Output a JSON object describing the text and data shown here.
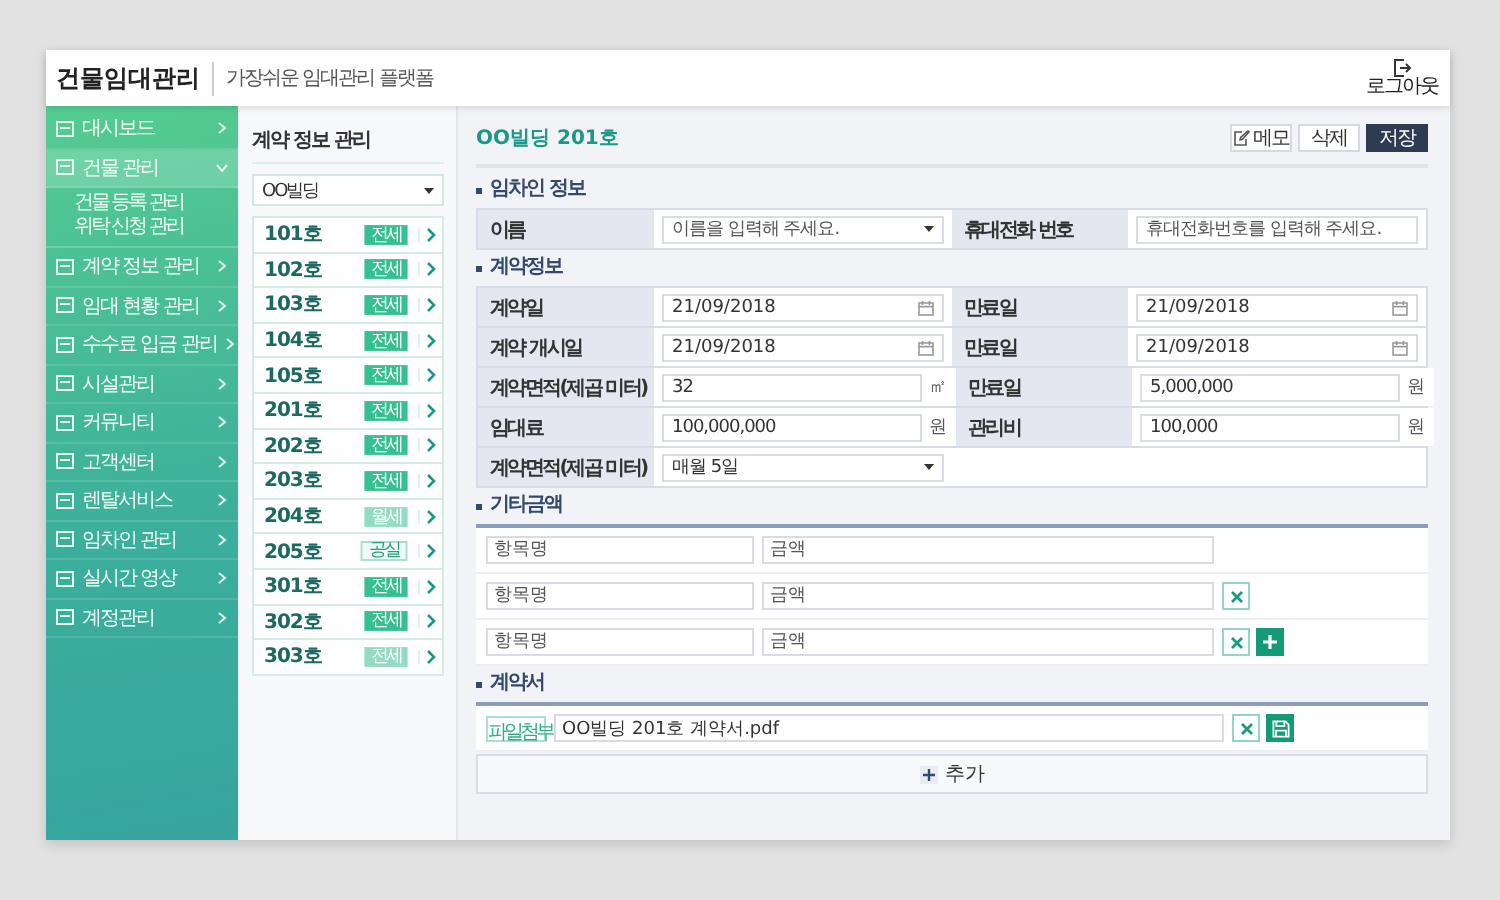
{
  "header": {
    "title": "건물임대관리",
    "subtitle": "가장쉬운 임대관리 플랫폼",
    "logout": "로그아웃"
  },
  "sidebar": {
    "items": [
      {
        "label": "대시보드",
        "selected": false,
        "expanded": false
      },
      {
        "label": "건물 관리",
        "selected": true,
        "expanded": true,
        "children": [
          {
            "label": "건물 등록 관리"
          },
          {
            "label": "위탁 신청 관리"
          }
        ]
      },
      {
        "label": "계약 정보 관리",
        "selected": false,
        "expanded": false
      },
      {
        "label": "임대 현황 관리",
        "selected": false,
        "expanded": false
      },
      {
        "label": "수수료 입금 관리",
        "selected": false,
        "expanded": false
      },
      {
        "label": "시설관리",
        "selected": false,
        "expanded": false
      },
      {
        "label": "커뮤니티",
        "selected": false,
        "expanded": false
      },
      {
        "label": "고객센터",
        "selected": false,
        "expanded": false
      },
      {
        "label": "렌탈서비스",
        "selected": false,
        "expanded": false
      },
      {
        "label": "임차인 관리",
        "selected": false,
        "expanded": false
      },
      {
        "label": "실시간 영상",
        "selected": false,
        "expanded": false
      },
      {
        "label": "계정관리",
        "selected": false,
        "expanded": false
      }
    ]
  },
  "units": {
    "title": "계약 정보 관리",
    "building": "OO빌딩",
    "items": [
      {
        "name": "101호",
        "badge": "전세",
        "kind": "solid"
      },
      {
        "name": "102호",
        "badge": "전세",
        "kind": "solid"
      },
      {
        "name": "103호",
        "badge": "전세",
        "kind": "solid"
      },
      {
        "name": "104호",
        "badge": "전세",
        "kind": "solid"
      },
      {
        "name": "105호",
        "badge": "전세",
        "kind": "solid"
      },
      {
        "name": "201호",
        "badge": "전세",
        "kind": "solid"
      },
      {
        "name": "202호",
        "badge": "전세",
        "kind": "solid"
      },
      {
        "name": "203호",
        "badge": "전세",
        "kind": "solid"
      },
      {
        "name": "204호",
        "badge": "월세",
        "kind": "light"
      },
      {
        "name": "205호",
        "badge": "공실",
        "kind": "outline"
      },
      {
        "name": "301호",
        "badge": "전세",
        "kind": "solid"
      },
      {
        "name": "302호",
        "badge": "전세",
        "kind": "solid"
      },
      {
        "name": "303호",
        "badge": "전세",
        "kind": "light"
      }
    ]
  },
  "detail": {
    "title": "OO빌딩 201호",
    "buttons": [
      {
        "label": "메모",
        "kind": "memo"
      },
      {
        "label": "삭제",
        "kind": "plain"
      },
      {
        "label": "저장",
        "kind": "primary"
      }
    ],
    "tenant": {
      "title": "임차인 정보",
      "rows": [
        {
          "cells": [
            {
              "label": "이름",
              "kind": "select",
              "placeholder": "이름을 입력해 주세요."
            },
            {
              "label": "휴대전화 번호",
              "kind": "text",
              "placeholder": "휴대전화번호를 입력해 주세요."
            }
          ]
        }
      ]
    },
    "contract": {
      "title": "계약정보",
      "rows": [
        {
          "cells": [
            {
              "label": "계약일",
              "kind": "date",
              "value": "21/09/2018"
            },
            {
              "label": "만료일",
              "kind": "date",
              "value": "21/09/2018"
            }
          ]
        },
        {
          "cells": [
            {
              "label": "계약 개시일",
              "kind": "date",
              "value": "21/09/2018"
            },
            {
              "label": "만료일",
              "kind": "date",
              "value": "21/09/2018"
            }
          ]
        },
        {
          "cells": [
            {
              "label": "계약면적(제곱 미터)",
              "kind": "text",
              "value": "32",
              "unit": "㎡"
            },
            {
              "label": "만료일",
              "kind": "text",
              "value": "5,000,000",
              "unit": "원"
            }
          ]
        },
        {
          "cells": [
            {
              "label": "임대료",
              "kind": "text",
              "value": "100,000,000",
              "unit": "원"
            },
            {
              "label": "관리비",
              "kind": "text",
              "value": "100,000",
              "unit": "원"
            }
          ]
        },
        {
          "cells": [
            {
              "label": "계약면적(제곱 미터)",
              "kind": "select",
              "value": "매월 5일"
            }
          ]
        }
      ]
    },
    "extra": {
      "title": "기타금액",
      "rows": [
        {
          "name_placeholder": "항목명",
          "amount_placeholder": "금액",
          "removable": false,
          "addable": false
        },
        {
          "name_placeholder": "항목명",
          "amount_placeholder": "금액",
          "removable": true,
          "addable": false
        },
        {
          "name_placeholder": "항목명",
          "amount_placeholder": "금액",
          "removable": true,
          "addable": true
        }
      ]
    },
    "files": {
      "title": "계약서",
      "attach": "파일첨부",
      "file": "OO빌딩 201호 계약서.pdf",
      "add": "추가"
    }
  }
}
